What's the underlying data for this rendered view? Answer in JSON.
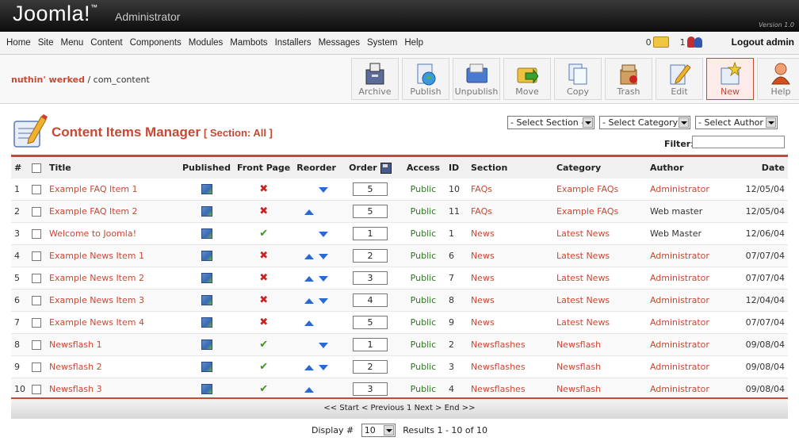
{
  "header": {
    "logo": "Joomla!",
    "logo_tm": "™",
    "subtitle": "Administrator",
    "version": "Version 1.0"
  },
  "menubar": {
    "items": [
      "Home",
      "Site",
      "Menu",
      "Content",
      "Components",
      "Modules",
      "Mambots",
      "Installers",
      "Messages",
      "System",
      "Help"
    ],
    "messages_count": "0",
    "users_count": "1",
    "logout": "Logout admin"
  },
  "breadcrumb": {
    "site": "nuthin' werked",
    "separator": " / ",
    "component": "com_content"
  },
  "toolbar": [
    {
      "label": "Archive",
      "icon": "archive-icon"
    },
    {
      "label": "Publish",
      "icon": "publish-icon"
    },
    {
      "label": "Unpublish",
      "icon": "unpublish-icon"
    },
    {
      "label": "Move",
      "icon": "move-icon"
    },
    {
      "label": "Copy",
      "icon": "copy-icon"
    },
    {
      "label": "Trash",
      "icon": "trash-icon"
    },
    {
      "label": "Edit",
      "icon": "edit-icon"
    },
    {
      "label": "New",
      "icon": "new-icon"
    },
    {
      "label": "Help",
      "icon": "help-icon"
    }
  ],
  "page": {
    "title": "Content Items Manager",
    "section": "[ Section: All ]"
  },
  "filters": {
    "section": "- Select Section -",
    "category": "- Select Category -",
    "author": "- Select Author -",
    "filter_label": "Filter:",
    "filter_value": ""
  },
  "table": {
    "headers": {
      "num": "#",
      "title": "Title",
      "published": "Published",
      "frontpage": "Front Page",
      "reorder": "Reorder",
      "order": "Order",
      "access": "Access",
      "id": "ID",
      "section": "Section",
      "category": "Category",
      "author": "Author",
      "date": "Date"
    },
    "rows": [
      {
        "num": "1",
        "title": "Example FAQ Item 1",
        "front": false,
        "up": false,
        "down": true,
        "order": "5",
        "access": "Public",
        "id": "10",
        "section": "FAQs",
        "category": "Example FAQs",
        "author": "Administrator",
        "author_link": true,
        "date": "12/05/04"
      },
      {
        "num": "2",
        "title": "Example FAQ Item 2",
        "front": false,
        "up": true,
        "down": false,
        "order": "5",
        "access": "Public",
        "id": "11",
        "section": "FAQs",
        "category": "Example FAQs",
        "author": "Web master",
        "author_link": false,
        "date": "12/05/04"
      },
      {
        "num": "3",
        "title": "Welcome to Joomla!",
        "front": true,
        "up": false,
        "down": true,
        "order": "1",
        "access": "Public",
        "id": "1",
        "section": "News",
        "category": "Latest News",
        "author": "Web Master",
        "author_link": false,
        "date": "12/06/04"
      },
      {
        "num": "4",
        "title": "Example News Item 1",
        "front": false,
        "up": true,
        "down": true,
        "order": "2",
        "access": "Public",
        "id": "6",
        "section": "News",
        "category": "Latest News",
        "author": "Administrator",
        "author_link": true,
        "date": "07/07/04"
      },
      {
        "num": "5",
        "title": "Example News Item 2",
        "front": false,
        "up": true,
        "down": true,
        "order": "3",
        "access": "Public",
        "id": "7",
        "section": "News",
        "category": "Latest News",
        "author": "Administrator",
        "author_link": true,
        "date": "07/07/04"
      },
      {
        "num": "6",
        "title": "Example News Item 3",
        "front": false,
        "up": true,
        "down": true,
        "order": "4",
        "access": "Public",
        "id": "8",
        "section": "News",
        "category": "Latest News",
        "author": "Administrator",
        "author_link": true,
        "date": "12/04/04"
      },
      {
        "num": "7",
        "title": "Example News Item 4",
        "front": false,
        "up": true,
        "down": false,
        "order": "5",
        "access": "Public",
        "id": "9",
        "section": "News",
        "category": "Latest News",
        "author": "Administrator",
        "author_link": true,
        "date": "07/07/04"
      },
      {
        "num": "8",
        "title": "Newsflash 1",
        "front": true,
        "up": false,
        "down": true,
        "order": "1",
        "access": "Public",
        "id": "2",
        "section": "Newsflashes",
        "category": "Newsflash",
        "author": "Administrator",
        "author_link": true,
        "date": "09/08/04"
      },
      {
        "num": "9",
        "title": "Newsflash 2",
        "front": true,
        "up": true,
        "down": true,
        "order": "2",
        "access": "Public",
        "id": "3",
        "section": "Newsflashes",
        "category": "Newsflash",
        "author": "Administrator",
        "author_link": true,
        "date": "09/08/04"
      },
      {
        "num": "10",
        "title": "Newsflash 3",
        "front": true,
        "up": true,
        "down": false,
        "order": "3",
        "access": "Public",
        "id": "4",
        "section": "Newsflashes",
        "category": "Newsflash",
        "author": "Administrator",
        "author_link": true,
        "date": "09/08/04"
      }
    ]
  },
  "pagination": {
    "start": "<< Start",
    "prev": "< Previous",
    "page": "1",
    "next": "Next >",
    "end": "End >>"
  },
  "display": {
    "label": "Display #",
    "value": "10",
    "results": "Results 1 - 10 of 10"
  },
  "colors": {
    "accent": "#c64934",
    "public": "#2a7a1a",
    "header": "#1e1e1e"
  }
}
